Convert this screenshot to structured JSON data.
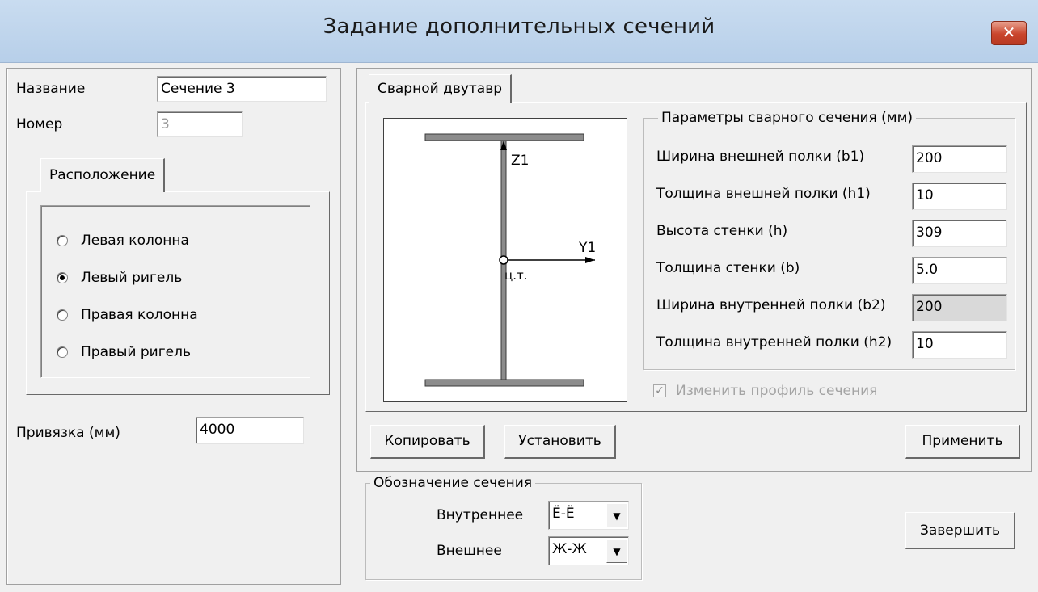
{
  "window": {
    "title": "Задание дополнительных сечений",
    "close_glyph": "✕"
  },
  "left": {
    "name_label": "Название",
    "name_value": "Сечение 3",
    "number_label": "Номер",
    "number_value": "3",
    "position_tab": "Расположение",
    "radios": [
      {
        "label": "Левая колонна",
        "checked": false
      },
      {
        "label": "Левый ригель",
        "checked": true
      },
      {
        "label": "Правая колонна",
        "checked": false
      },
      {
        "label": "Правый ригель",
        "checked": false
      }
    ],
    "anchor_label": "Привязка (мм)",
    "anchor_value": "4000"
  },
  "right": {
    "section_tab": "Сварной двутавр",
    "drawing": {
      "z_axis": "Z1",
      "y_axis": "Y1",
      "center": "ц.т."
    },
    "params_group": "Параметры сварного сечения (мм)",
    "params": [
      {
        "label": "Ширина внешней полки (b1)",
        "value": "200",
        "disabled": false
      },
      {
        "label": "Толщина внешней полки (h1)",
        "value": "10",
        "disabled": false
      },
      {
        "label": "Высота стенки  (h)",
        "value": "309",
        "disabled": false
      },
      {
        "label": "Толщина стенки (b)",
        "value": "5.0",
        "disabled": false
      },
      {
        "label": "Ширина внутренней полки (b2)",
        "value": "200",
        "disabled": true
      },
      {
        "label": "Толщина внутренней полки (h2)",
        "value": "10",
        "disabled": false
      }
    ],
    "change_profile": {
      "label": "Изменить профиль сечения",
      "checked": true,
      "enabled": false
    },
    "copy_button": "Копировать",
    "set_button": "Установить",
    "apply_button": "Применить"
  },
  "designation": {
    "group": "Обозначение сечения",
    "inner_label": "Внутреннее",
    "inner_value": "Ё-Ё",
    "outer_label": "Внешнее",
    "outer_value": "Ж-Ж"
  },
  "finish_button": "Завершить"
}
